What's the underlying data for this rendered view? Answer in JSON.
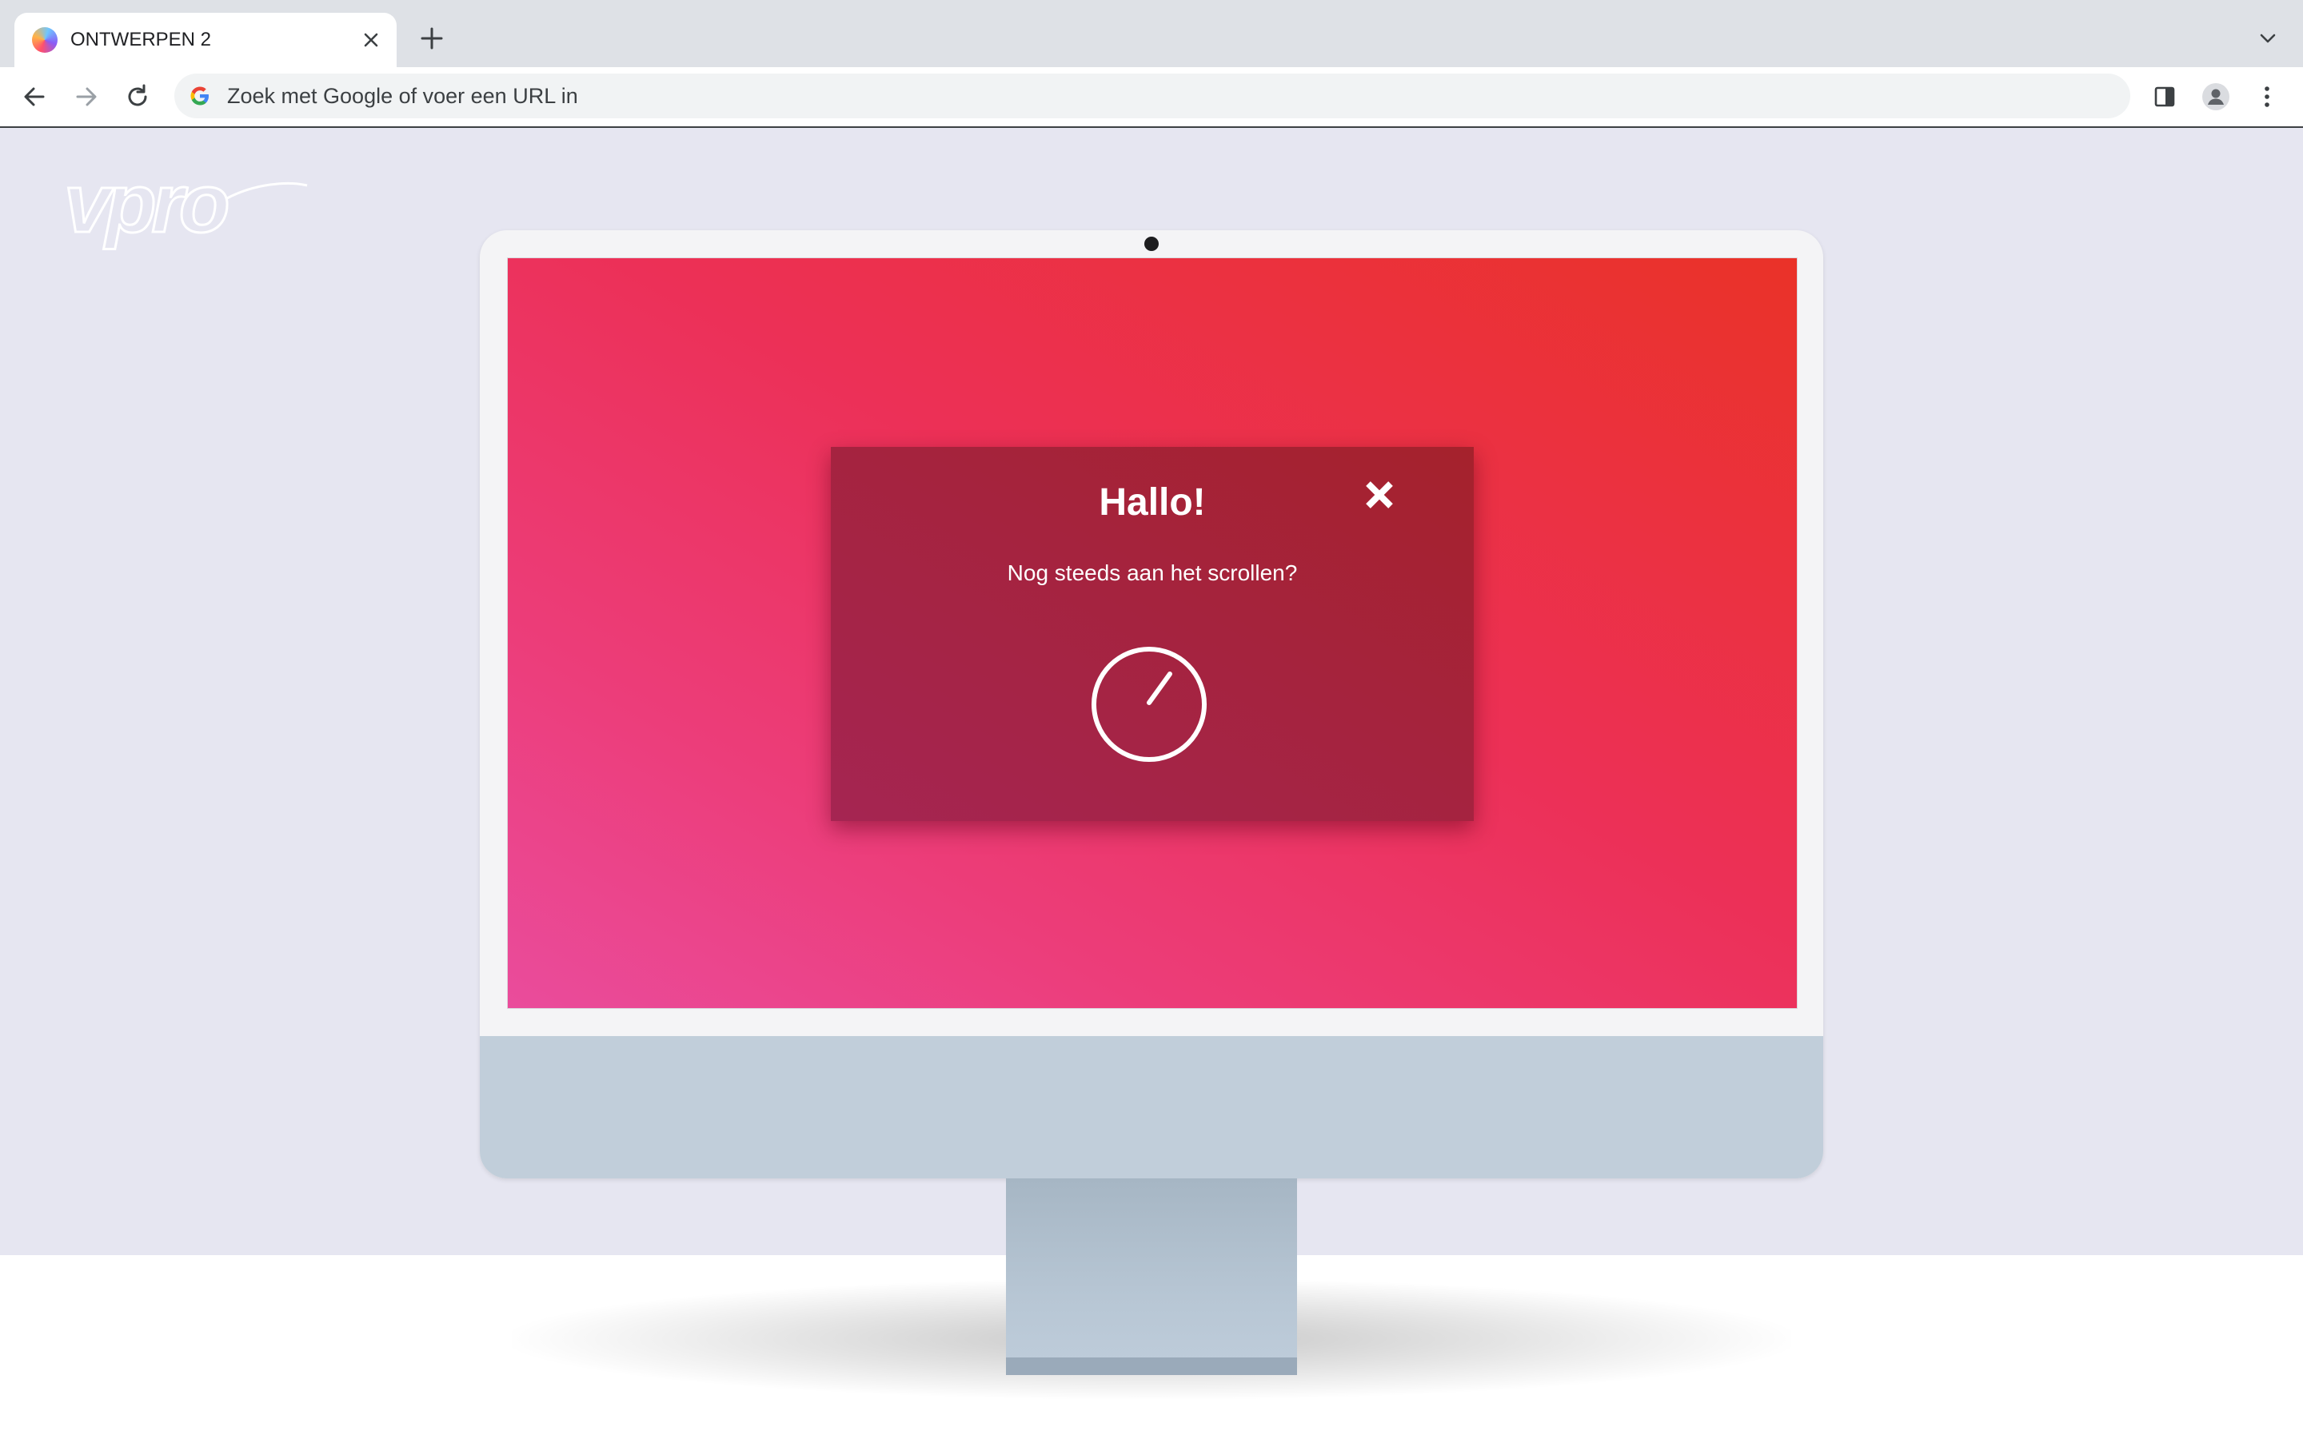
{
  "browser": {
    "tab_title": "ONTWERPEN 2",
    "omnibox_placeholder": "Zoek met Google of voer een URL in"
  },
  "page": {
    "logo_text": "vpro"
  },
  "modal": {
    "title": "Hallo!",
    "message": "Nog steeds aan het scrollen?"
  },
  "colors": {
    "page_bg": "#e6e6f1",
    "screen_gradient_start": "#ea4c9c",
    "screen_gradient_end": "#ea3228",
    "modal_bg": "#a5233e",
    "imac_chin": "#c1ceda"
  }
}
